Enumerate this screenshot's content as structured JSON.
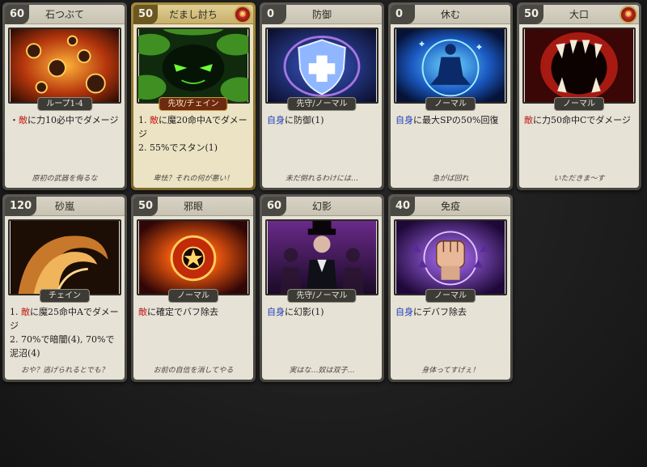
{
  "cards": [
    {
      "cost": "60",
      "name": "石つぶて",
      "tag": "ループ1-4",
      "lines": [
        [
          "・",
          "敵",
          "に力10必中でダメージ"
        ]
      ],
      "flavor": "原初の武器を侮るな"
    },
    {
      "cost": "50",
      "name": "だまし討ち",
      "tag": "先攻/チェイン",
      "lines": [
        [
          "1. ",
          "敵",
          "に魔20命中Aでダメージ"
        ],
        [
          "2. 55%でスタン(1)"
        ]
      ],
      "flavor": "卑怯？それの何が悪い！"
    },
    {
      "cost": "0",
      "name": "防御",
      "tag": "先守/ノーマル",
      "lines": [
        [
          "",
          "自身",
          "に防御(1)"
        ]
      ],
      "flavor": "未だ倒れるわけには…"
    },
    {
      "cost": "0",
      "name": "休む",
      "tag": "ノーマル",
      "lines": [
        [
          "",
          "自身",
          "に最大SPの50%回復"
        ]
      ],
      "flavor": "急がば回れ"
    },
    {
      "cost": "50",
      "name": "大口",
      "tag": "ノーマル",
      "lines": [
        [
          "",
          "敵",
          "に力50命中Cでダメージ"
        ]
      ],
      "flavor": "いただきま～す"
    },
    {
      "cost": "120",
      "name": "砂嵐",
      "tag": "チェイン",
      "lines": [
        [
          "1. ",
          "敵",
          "に魔25命中Aでダメージ"
        ],
        [
          "2. 70%で暗闇(4), 70%で泥沼(4)"
        ]
      ],
      "flavor": "おや？逃げられるとでも？"
    },
    {
      "cost": "50",
      "name": "邪眼",
      "tag": "ノーマル",
      "lines": [
        [
          "",
          "敵",
          "に確定でバフ除去"
        ]
      ],
      "flavor": "お前の自信を消してやる"
    },
    {
      "cost": "60",
      "name": "幻影",
      "tag": "先守/ノーマル",
      "lines": [
        [
          "",
          "自身",
          "に幻影(1)"
        ]
      ],
      "flavor": "実はな…奴は双子…"
    },
    {
      "cost": "40",
      "name": "免疫",
      "tag": "ノーマル",
      "lines": [
        [
          "",
          "自身",
          "にデバフ除去"
        ]
      ],
      "flavor": "身体ってすげぇ！"
    }
  ],
  "colors": {
    "enemy": "#c8201c",
    "self": "#1f3fb8",
    "gold_card": "#a48a3c",
    "silver_card": "#5b5952"
  },
  "icons": [
    "fireball-rocks-icon",
    "forest-eyes-icon",
    "shield-cross-icon",
    "meditation-icon",
    "monster-mouth-icon",
    "sand-wave-icon",
    "evil-eye-icon",
    "shadow-clones-icon",
    "fist-icon",
    "special-seal-icon"
  ]
}
